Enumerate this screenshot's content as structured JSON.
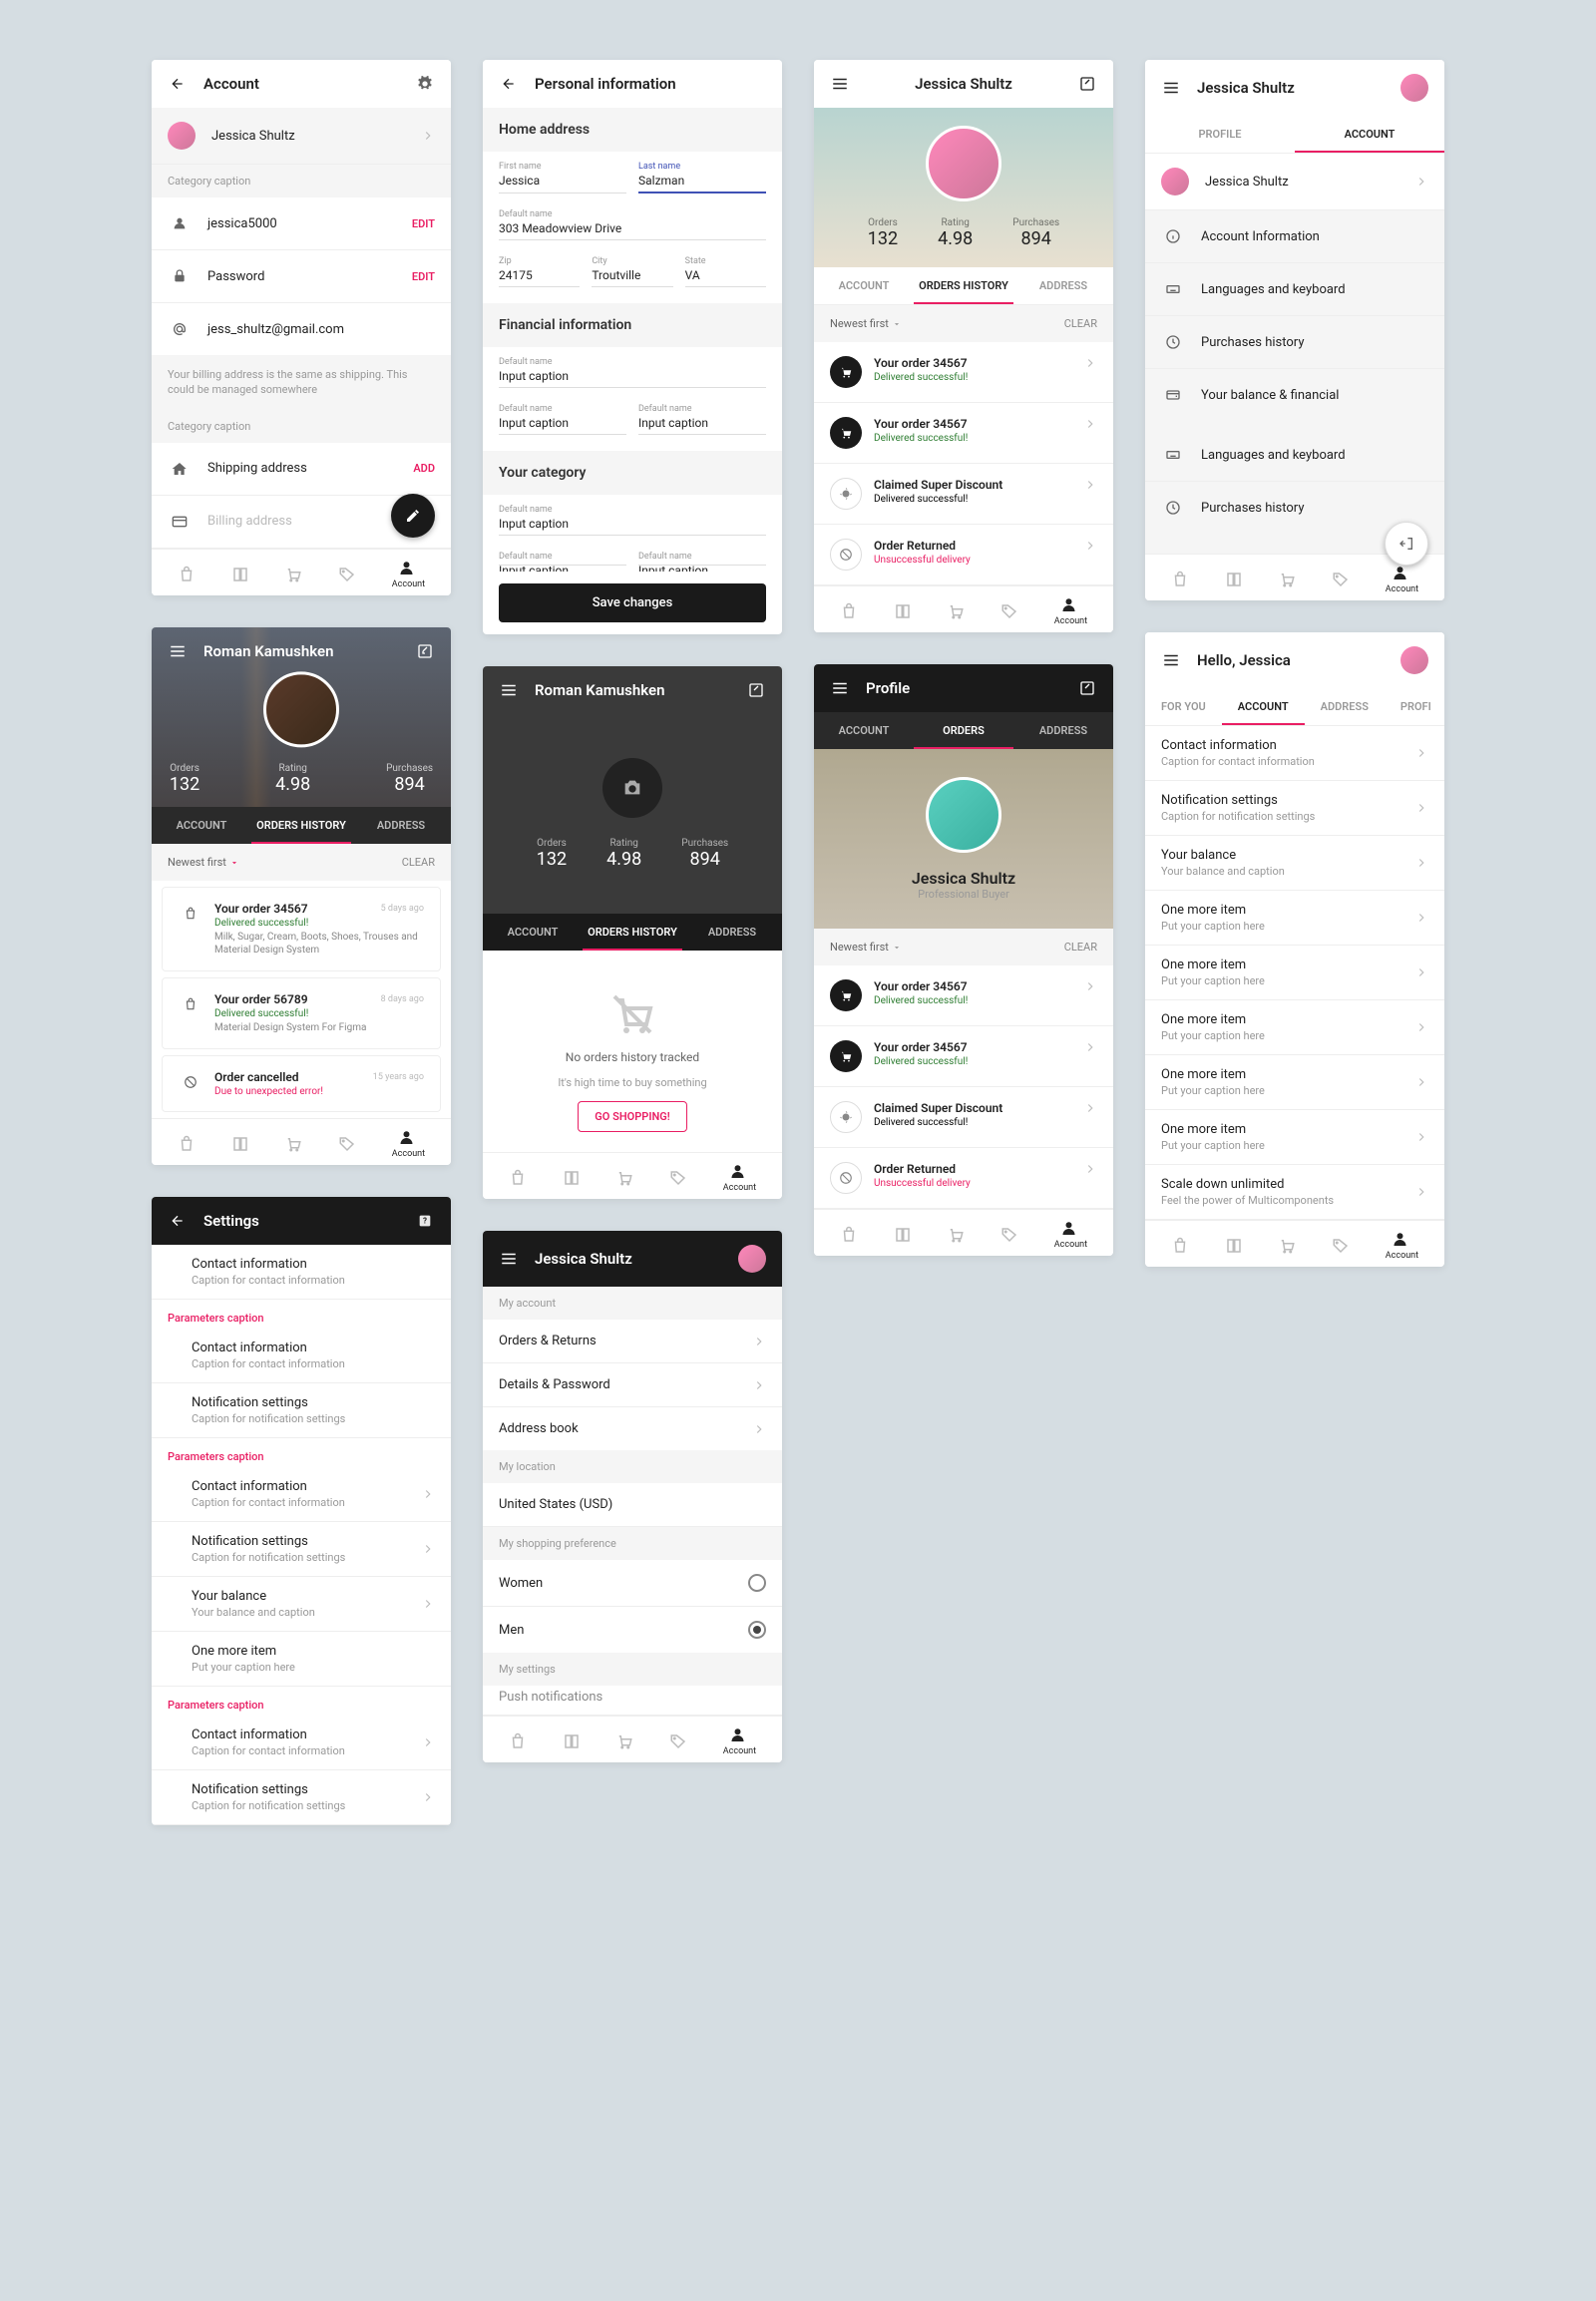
{
  "s1": {
    "title": "Account",
    "user": "Jessica Shultz",
    "cat": "Category caption",
    "items": [
      {
        "icon": "person",
        "text": "jessica5000",
        "action": "EDIT"
      },
      {
        "icon": "lock",
        "text": "Password",
        "action": "EDIT"
      },
      {
        "icon": "at",
        "text": "jess_shultz@gmail.com",
        "action": ""
      }
    ],
    "note": "Your billing address is the same as shipping. This could be managed somewhere",
    "cat2": "Category caption",
    "ship": {
      "icon": "home",
      "text": "Shipping address",
      "action": "ADD"
    },
    "bill": {
      "icon": "card",
      "text": "Billing address"
    },
    "navLabel": "Account"
  },
  "s2": {
    "title": "Personal information",
    "h1": "Home address",
    "f": [
      {
        "l": "First name",
        "v": "Jessica"
      },
      {
        "l": "Last name",
        "v": "Salzman",
        "focus": true
      },
      {
        "l": "Default name",
        "v": "303 Meadowview Drive"
      },
      {
        "l": "Zip",
        "v": "24175"
      },
      {
        "l": "City",
        "v": "Troutville"
      },
      {
        "l": "State",
        "v": "VA"
      }
    ],
    "h2": "Financial information",
    "g": [
      {
        "l": "Default name",
        "v": "Input caption"
      },
      {
        "l": "Default name",
        "v": "Input caption"
      },
      {
        "l": "Default name",
        "v": "Input caption"
      }
    ],
    "h3": "Your category",
    "k": [
      {
        "l": "Default name",
        "v": "Input caption"
      },
      {
        "l": "Default name",
        "v": "Input caption"
      },
      {
        "l": "Default name",
        "v": "Input caption"
      }
    ],
    "btn": "Save changes"
  },
  "s3": {
    "title": "Jessica Shultz",
    "stats": [
      {
        "l": "Orders",
        "v": "132"
      },
      {
        "l": "Rating",
        "v": "4.98"
      },
      {
        "l": "Purchases",
        "v": "894"
      }
    ],
    "tabs": [
      "ACCOUNT",
      "ORDERS HISTORY",
      "ADDRESS"
    ],
    "filter": "Newest first",
    "clear": "CLEAR",
    "orders": [
      {
        "t": "Your order 34567",
        "s": "Delivered successful!",
        "ok": true,
        "ico": "cart"
      },
      {
        "t": "Your order 34567",
        "s": "Delivered successful!",
        "ok": true,
        "ico": "cart"
      },
      {
        "t": "Claimed Super Discount",
        "s": "Delivered successful!",
        "ok": false,
        "ico": "badge"
      },
      {
        "t": "Order Returned",
        "s": "Unsuccessful delivery",
        "ok": false,
        "ico": "block",
        "red": true
      }
    ],
    "navLabel": "Account"
  },
  "s4": {
    "title": "Jessica Shultz",
    "tabs": [
      "PROFILE",
      "ACCOUNT"
    ],
    "user": "Jessica Shultz",
    "items": [
      "Account Information",
      "Languages and keyboard",
      "Purchases history",
      "Your balance & financial"
    ],
    "items2": [
      "Languages and keyboard",
      "Purchases history"
    ],
    "navLabel": "Account"
  },
  "s5": {
    "title": "Roman Kamushken",
    "stats": [
      {
        "l": "Orders",
        "v": "132"
      },
      {
        "l": "Rating",
        "v": "4.98"
      },
      {
        "l": "Purchases",
        "v": "894"
      }
    ],
    "tabs": [
      "ACCOUNT",
      "ORDERS HISTORY",
      "ADDRESS"
    ],
    "filter": "Newest first",
    "clear": "CLEAR",
    "orders": [
      {
        "t": "Your order 34567",
        "time": "5 days ago",
        "s": "Delivered successful!",
        "d": "Milk, Sugar, Cream, Boots, Shoes, Trouses and Material Design System"
      },
      {
        "t": "Your order 56789",
        "time": "8 days ago",
        "s": "Delivered successful!",
        "d": "Material Design System For Figma"
      },
      {
        "t": "Order cancelled",
        "time": "15 years ago",
        "s": "Due to unexpected error!",
        "red": true
      }
    ],
    "navLabel": "Account"
  },
  "s6": {
    "title": "Roman Kamushken",
    "stats": [
      {
        "l": "Orders",
        "v": "132"
      },
      {
        "l": "Rating",
        "v": "4.98"
      },
      {
        "l": "Purchases",
        "v": "894"
      }
    ],
    "tabs": [
      "ACCOUNT",
      "ORDERS HISTORY",
      "ADDRESS"
    ],
    "e1": "No orders history tracked",
    "e2": "It's high time to buy something",
    "btn": "GO SHOPPING!",
    "navLabel": "Account"
  },
  "s7": {
    "title": "Profile",
    "tabs": [
      "ACCOUNT",
      "ORDERS",
      "ADDRESS"
    ],
    "name": "Jessica Shultz",
    "role": "Professional Buyer",
    "filter": "Newest first",
    "clear": "CLEAR",
    "orders": [
      {
        "t": "Your order 34567",
        "s": "Delivered successful!",
        "ok": true,
        "ico": "cart"
      },
      {
        "t": "Your order 34567",
        "s": "Delivered successful!",
        "ok": true,
        "ico": "cart"
      },
      {
        "t": "Claimed Super Discount",
        "s": "Delivered successful!",
        "ok": false,
        "ico": "badge"
      },
      {
        "t": "Order Returned",
        "s": "Unsuccessful delivery",
        "ok": false,
        "ico": "block",
        "red": true
      }
    ],
    "navLabel": "Account"
  },
  "s8": {
    "title": "Hello, Jessica",
    "tabs": [
      "FOR YOU",
      "ACCOUNT",
      "ADDRESS",
      "PROFI"
    ],
    "rows": [
      {
        "t": "Contact information",
        "s": "Caption for contact information"
      },
      {
        "t": "Notification settings",
        "s": "Caption for notification settings"
      },
      {
        "t": "Your balance",
        "s": "Your balance and caption"
      },
      {
        "t": "One more item",
        "s": "Put your caption here"
      },
      {
        "t": "One more item",
        "s": "Put your caption here"
      },
      {
        "t": "One more item",
        "s": "Put your caption here"
      },
      {
        "t": "One more item",
        "s": "Put your caption here"
      },
      {
        "t": "One more item",
        "s": "Put your caption here"
      },
      {
        "t": "Scale down unlimited",
        "s": "Feel the power of Multicomponents"
      }
    ],
    "navLabel": "Account"
  },
  "s9": {
    "title": "Settings",
    "groups": [
      {
        "cap": "",
        "rows": [
          {
            "t": "Contact information",
            "s": "Caption for contact information"
          }
        ]
      },
      {
        "cap": "Parameters caption",
        "rows": [
          {
            "t": "Contact information",
            "s": "Caption for contact information"
          },
          {
            "t": "Notification settings",
            "s": "Caption for notification settings"
          }
        ]
      },
      {
        "cap": "Parameters caption",
        "rows": [
          {
            "t": "Contact information",
            "s": "Caption for contact information",
            "chev": true
          },
          {
            "t": "Notification settings",
            "s": "Caption for notification settings",
            "chev": true
          },
          {
            "t": "Your balance",
            "s": "Your balance and caption",
            "chev": true
          },
          {
            "t": "One more item",
            "s": "Put your caption here"
          }
        ]
      },
      {
        "cap": "Parameters caption",
        "rows": [
          {
            "t": "Contact information",
            "s": "Caption for contact information",
            "chev": true
          },
          {
            "t": "Notification settings",
            "s": "Caption for notification settings",
            "chev": true
          }
        ]
      }
    ]
  },
  "s10": {
    "title": "Jessica Shultz",
    "h1": "My account",
    "acc": [
      "Orders & Returns",
      "Details & Password",
      "Address book"
    ],
    "h2": "My location",
    "loc": "United States (USD)",
    "h3": "My shopping preference",
    "opts": [
      {
        "t": "Women",
        "c": false
      },
      {
        "t": "Men",
        "c": true
      }
    ],
    "h4": "My settings",
    "set": "Push notifications",
    "navLabel": "Account"
  }
}
